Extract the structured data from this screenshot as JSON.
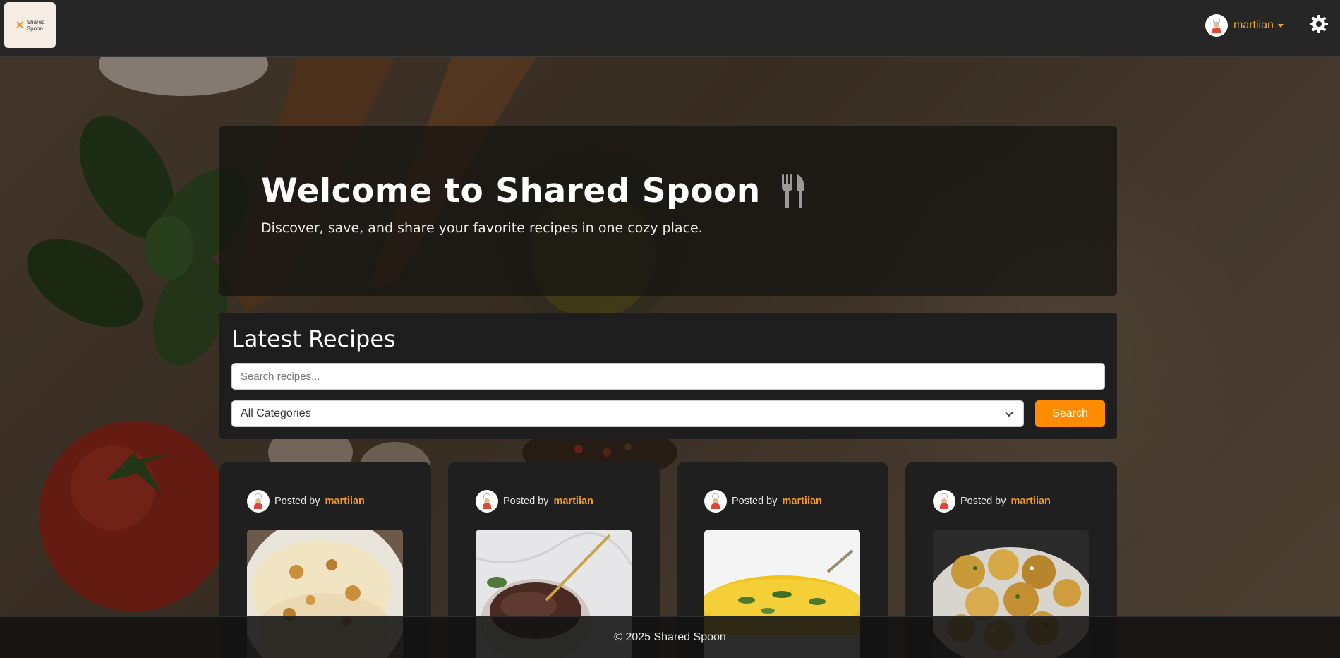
{
  "navbar": {
    "logo_line1": "Shared",
    "logo_line2": "Spoon",
    "username": "martiian"
  },
  "hero": {
    "title": "Welcome to Shared Spoon",
    "subtitle": "Discover, save, and share your favorite recipes in one cozy place."
  },
  "latest": {
    "title": "Latest Recipes",
    "search_placeholder": "Search recipes...",
    "category_selected": "All Categories",
    "search_button": "Search"
  },
  "cards": [
    {
      "posted_by_label": "Posted by",
      "author": "martiian",
      "image": "naan-flatbread-photo"
    },
    {
      "posted_by_label": "Posted by",
      "author": "martiian",
      "image": "chocolate-pudding-photo"
    },
    {
      "posted_by_label": "Posted by",
      "author": "martiian",
      "image": "saffron-rice-photo"
    },
    {
      "posted_by_label": "Posted by",
      "author": "martiian",
      "image": "roasted-potatoes-photo"
    }
  ],
  "footer": {
    "text": "© 2025 Shared Spoon"
  },
  "colors": {
    "accent": "#ff8c00",
    "username": "#f0a830",
    "navbar_bg": "#262626",
    "panel_bg": "#1e1e1e"
  }
}
